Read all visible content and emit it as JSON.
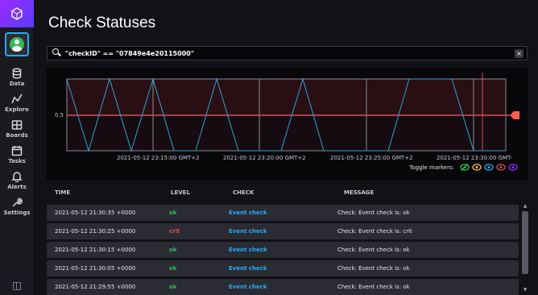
{
  "app": {
    "logo_icon": "influx-logo-icon",
    "colors": {
      "accent": "#22adf6",
      "ok": "#34bb55",
      "crit": "#dc4e58",
      "brand": "#9b2aff"
    }
  },
  "sidebar": {
    "items": [
      {
        "label": "Data",
        "icon": "database-icon"
      },
      {
        "label": "Explore",
        "icon": "graph-line-icon"
      },
      {
        "label": "Boards",
        "icon": "dashboard-icon"
      },
      {
        "label": "Tasks",
        "icon": "calendar-icon"
      },
      {
        "label": "Alerts",
        "icon": "bell-icon"
      },
      {
        "label": "Settings",
        "icon": "wrench-icon"
      }
    ]
  },
  "page": {
    "title": "Check Statuses"
  },
  "search": {
    "value": "\"checkID\" == \"07849e4e20115000\""
  },
  "graph": {
    "y_tick": "0.5",
    "x_ticks": [
      "2021-05-12 23:15:00 GMT+2",
      "2021-05-12 23:20:00 GMT+2",
      "2021-05-12 23:25:00 GMT+2",
      "2021-05-12 23:30:00 GMT-"
    ],
    "toggle_label": "Toggle markers:",
    "markers": [
      {
        "icon": "eye-slash-icon",
        "color": "#34bb55"
      },
      {
        "icon": "eye-icon",
        "color": "#ffb94a"
      },
      {
        "icon": "eye-icon",
        "color": "#22adf6"
      },
      {
        "icon": "eye-icon",
        "color": "#dc4e58"
      },
      {
        "icon": "eye-icon",
        "color": "#9b2aff"
      }
    ]
  },
  "table": {
    "headers": {
      "time": "TIME",
      "level": "LEVEL",
      "check": "CHECK",
      "message": "MESSAGE"
    },
    "rows": [
      {
        "time": "2021-05-12 21:30:35 +0000",
        "level": "ok",
        "check": "Event check",
        "message": "Check: Event check is: ok"
      },
      {
        "time": "2021-05-12 21:30:25 +0000",
        "level": "crit",
        "check": "Event check",
        "message": "Check: Event check is: crit"
      },
      {
        "time": "2021-05-12 21:30:15 +0000",
        "level": "ok",
        "check": "Event check",
        "message": "Check: Event check is: ok"
      },
      {
        "time": "2021-05-12 21:30:05 +0000",
        "level": "ok",
        "check": "Event check",
        "message": "Check: Event check is: ok"
      },
      {
        "time": "2021-05-12 21:29:55 +0000",
        "level": "ok",
        "check": "Event check",
        "message": "Check: Event check is: ok"
      }
    ]
  }
}
